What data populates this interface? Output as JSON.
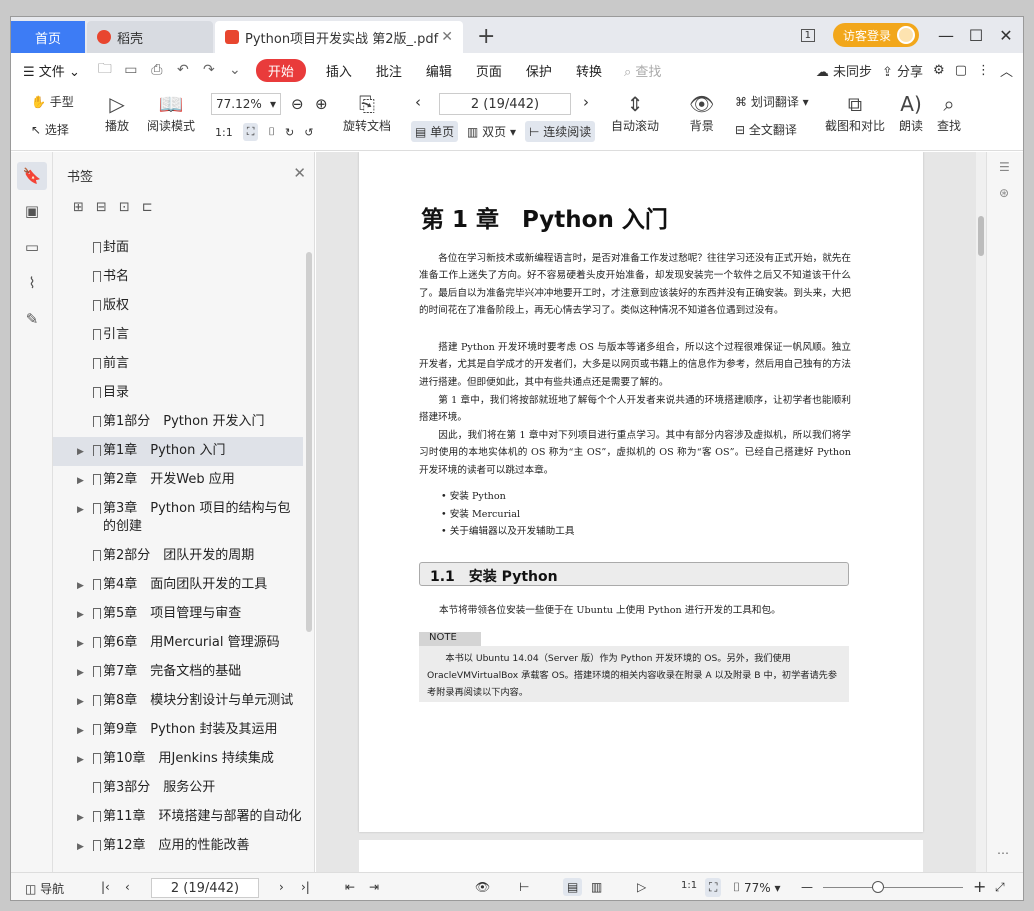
{
  "tabs": {
    "home": "首页",
    "daoke": "稻壳",
    "pdf": "Python项目开发实战 第2版_.pdf",
    "add": "+"
  },
  "titlebar": {
    "badge": "1",
    "login": "访客登录",
    "min": "—",
    "max": "☐",
    "close": "✕"
  },
  "menu": {
    "file": "文件",
    "items": [
      "开始",
      "插入",
      "批注",
      "编辑",
      "页面",
      "保护",
      "转换"
    ],
    "search": "查找",
    "sync": "未同步",
    "share": "分享"
  },
  "ribbon": {
    "hand": "手型",
    "select": "选择",
    "play": "播放",
    "read_mode": "阅读模式",
    "zoom": "77.12%",
    "rotate_doc": "旋转文档",
    "page_value": "2 (19/442)",
    "single": "单页",
    "double": "双页",
    "continuous": "连续阅读",
    "auto_scroll": "自动滚动",
    "background": "背景",
    "word_translate": "划词翻译",
    "full_translate": "全文翻译",
    "compare": "截图和对比",
    "read_aloud": "朗读",
    "find": "查找"
  },
  "bookmarks": {
    "title": "书签",
    "items": [
      {
        "label": "封面",
        "arrow": false
      },
      {
        "label": "书名",
        "arrow": false
      },
      {
        "label": "版权",
        "arrow": false
      },
      {
        "label": "引言",
        "arrow": false
      },
      {
        "label": "前言",
        "arrow": false
      },
      {
        "label": "目录",
        "arrow": false
      },
      {
        "label": "第1部分　Python 开发入门",
        "arrow": false
      },
      {
        "label": "第1章　Python 入门",
        "arrow": true,
        "selected": true
      },
      {
        "label": "第2章　开发Web 应用",
        "arrow": true
      },
      {
        "label": "第3章　Python 项目的结构与包的创建",
        "arrow": true
      },
      {
        "label": "第2部分　团队开发的周期",
        "arrow": false
      },
      {
        "label": "第4章　面向团队开发的工具",
        "arrow": true
      },
      {
        "label": "第5章　项目管理与审查",
        "arrow": true
      },
      {
        "label": "第6章　用Mercurial 管理源码",
        "arrow": true
      },
      {
        "label": "第7章　完备文档的基础",
        "arrow": true
      },
      {
        "label": "第8章　模块分割设计与单元测试",
        "arrow": true
      },
      {
        "label": "第9章　Python 封装及其运用",
        "arrow": true
      },
      {
        "label": "第10章　用Jenkins 持续集成",
        "arrow": true
      },
      {
        "label": "第3部分　服务公开",
        "arrow": false
      },
      {
        "label": "第11章　环境搭建与部署的自动化",
        "arrow": true
      },
      {
        "label": "第12章　应用的性能改善",
        "arrow": true
      }
    ]
  },
  "doc": {
    "chapter_title": "第 1 章　Python 入门",
    "p1": "各位在学习新技术或新编程语言时，是否对准备工作发过愁呢？往往学习还没有正式开始，就先在准备工作上迷失了方向。好不容易硬着头皮开始准备，却发现安装完一个软件之后又不知道该干什么了。最后自以为准备完毕兴冲冲地要开工时，才注意到应该装好的东西并没有正确安装。到头来，大把的时间花在了准备阶段上，再无心情去学习了。类似这种情况不知道各位遇到过没有。",
    "p2": "搭建 Python 开发环境时要考虑 OS 与版本等诸多组合，所以这个过程很难保证一帆风顺。独立开发者，尤其是自学成才的开发者们，大多是以网页或书籍上的信息作为参考，然后用自己独有的方法进行搭建。但即便如此，其中有些共通点还是需要了解的。",
    "p3": "第 1 章中，我们将按部就班地了解每个个人开发者来说共通的环境搭建顺序，让初学者也能顺利搭建环境。",
    "p4": "因此，我们将在第 1 章中对下列项目进行重点学习。其中有部分内容涉及虚拟机，所以我们将学习时使用的本地实体机的 OS 称为“主 OS”，虚拟机的 OS 称为“客 OS”。已经自己搭建好 Python 开发环境的读者可以跳过本章。",
    "bullets": [
      "安装 Python",
      "安装 Mercurial",
      "关于编辑器以及开发辅助工具"
    ],
    "section": "1.1　安装 Python",
    "section_desc": "本节将带领各位安装一些便于在 Ubuntu 上使用 Python 进行开发的工具和包。",
    "note_label": "NOTE",
    "note_text": "本书以 Ubuntu 14.04（Server 版）作为 Python 开发环境的 OS。另外，我们使用 OracleVMVirtualBox 承载客 OS。搭建环境的相关内容收录在附录 A 以及附录 B 中，初学者请先参考附录再阅读以下内容。"
  },
  "status": {
    "nav": "导航",
    "page_value": "2 (19/442)",
    "zoom": "77%"
  },
  "colors": {
    "accent_blue": "#3d7cf5",
    "accent_red": "#e93b3b",
    "login_orange": "#f2a71b"
  }
}
